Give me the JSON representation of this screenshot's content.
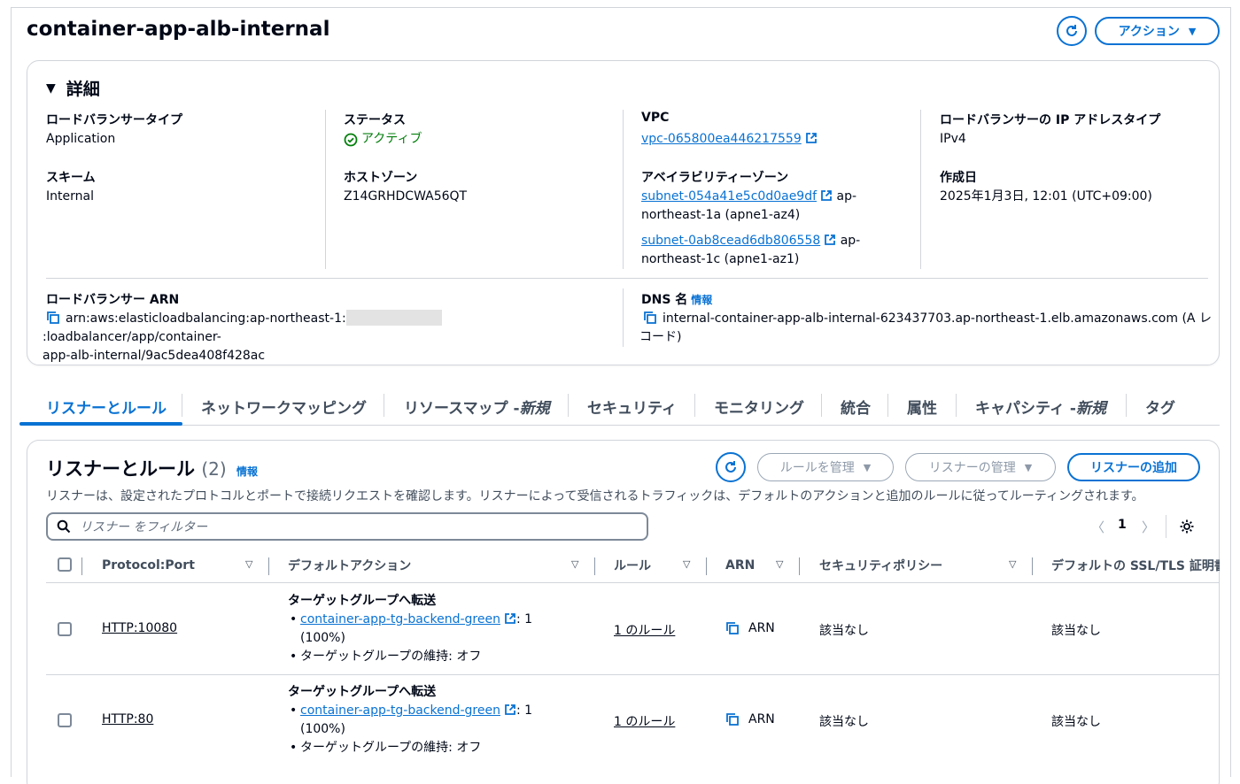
{
  "header": {
    "title": "container-app-alb-internal",
    "actions_label": "アクション"
  },
  "details": {
    "heading": "詳細",
    "lb_type_label": "ロードバランサータイプ",
    "lb_type_value": "Application",
    "status_label": "ステータス",
    "status_value": "アクティブ",
    "vpc_label": "VPC",
    "vpc_value": "vpc-065800ea446217559",
    "ip_type_label": "ロードバランサーの IP アドレスタイプ",
    "ip_type_value": "IPv4",
    "scheme_label": "スキーム",
    "scheme_value": "Internal",
    "hosted_zone_label": "ホストゾーン",
    "hosted_zone_value": "Z14GRHDCWA56QT",
    "az_label": "アベイラビリティーゾーン",
    "az_1_subnet": "subnet-054a41e5c0d0ae9df",
    "az_1_suffix": "ap-",
    "az_1_zone": "northeast-1a (apne1-az4)",
    "az_2_subnet": "subnet-0ab8cead6db806558",
    "az_2_suffix": "ap-",
    "az_2_zone": "northeast-1c (apne1-az1)",
    "created_label": "作成日",
    "created_value": "2025年1月3日, 12:01 (UTC+09:00)",
    "arn_label": "ロードバランサー ARN",
    "arn_prefix": "arn:aws:elasticloadbalancing:ap-northeast-1:",
    "arn_suffix": ":loadbalancer/app/container-",
    "arn_line2": "app-alb-internal/9ac5dea408f428ac",
    "dns_label": "DNS 名",
    "dns_info": "情報",
    "dns_value": "internal-container-app-alb-internal-623437703.ap-northeast-1.elb.amazonaws.com (A レ",
    "dns_line2": "コード)"
  },
  "tabs": [
    {
      "label": "リスナーとルール"
    },
    {
      "label": "ネットワークマッピング"
    },
    {
      "label": "リソースマップ - ",
      "em": "新規"
    },
    {
      "label": "セキュリティ"
    },
    {
      "label": "モニタリング"
    },
    {
      "label": "統合"
    },
    {
      "label": "属性"
    },
    {
      "label": "キャパシティ - ",
      "em": "新規"
    },
    {
      "label": "タグ"
    }
  ],
  "listeners": {
    "title": "リスナーとルール",
    "count": "(2)",
    "info": "情報",
    "manage_rules": "ルールを管理",
    "manage_listeners": "リスナーの管理",
    "add_listener": "リスナーの追加",
    "description": "リスナーは、設定されたプロトコルとポートで接続リクエストを確認します。リスナーによって受信されるトラフィックは、デフォルトのアクションと追加のルールに従ってルーティングされます。",
    "filter_placeholder": "リスナー をフィルター",
    "page": "1",
    "columns": [
      "Protocol:Port",
      "デフォルトアクション",
      "ルール",
      "ARN",
      "セキュリティポリシー",
      "デフォルトの SSL/TLS 証明書"
    ],
    "rows": [
      {
        "protocol_port": "HTTP:10080",
        "action_title": "ターゲットグループへ転送",
        "tg_name": "container-app-tg-backend-green",
        "tg_weight": ": 1",
        "tg_pct": "(100%)",
        "stickiness": "ターゲットグループの維持: オフ",
        "rules": "1 のルール",
        "arn": "ARN",
        "security_policy": "該当なし",
        "ssl_cert": "該当なし"
      },
      {
        "protocol_port": "HTTP:80",
        "action_title": "ターゲットグループへ転送",
        "tg_name": "container-app-tg-backend-green",
        "tg_weight": ": 1",
        "tg_pct": "(100%)",
        "stickiness": "ターゲットグループの維持: オフ",
        "rules": "1 のルール",
        "arn": "ARN",
        "security_policy": "該当なし",
        "ssl_cert": "該当なし"
      }
    ]
  }
}
